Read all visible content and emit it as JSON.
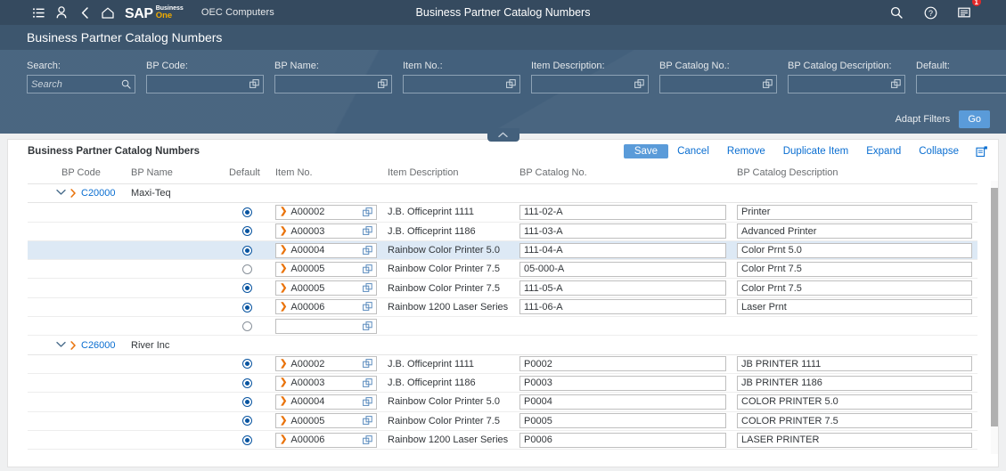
{
  "shell": {
    "icons": [
      "menu-icon",
      "user-icon",
      "back-icon",
      "home-icon"
    ],
    "logo": {
      "sap": "SAP",
      "business": "Business",
      "one": "One"
    },
    "company": "OEC Computers",
    "title": "Business Partner Catalog Numbers",
    "right_icons": [
      "search-icon",
      "help-icon",
      "messages-icon"
    ],
    "notification_count": "1"
  },
  "page": {
    "title": "Business Partner Catalog Numbers"
  },
  "filters": {
    "fields": [
      {
        "label": "Search:",
        "value": "",
        "placeholder": "Search",
        "icon": "search-icon",
        "width": 122
      },
      {
        "label": "BP Code:",
        "value": "",
        "placeholder": "",
        "icon": "value-help-icon",
        "width": 132
      },
      {
        "label": "BP Name:",
        "value": "",
        "placeholder": "",
        "icon": "value-help-icon",
        "width": 132
      },
      {
        "label": "Item No.:",
        "value": "",
        "placeholder": "",
        "icon": "value-help-icon",
        "width": 132
      },
      {
        "label": "Item Description:",
        "value": "",
        "placeholder": "",
        "icon": "value-help-icon",
        "width": 132
      },
      {
        "label": "BP Catalog No.:",
        "value": "",
        "placeholder": "",
        "icon": "value-help-icon",
        "width": 132
      },
      {
        "label": "BP Catalog Description:",
        "value": "",
        "placeholder": "",
        "icon": "value-help-icon",
        "width": 132
      },
      {
        "label": "Default:",
        "value": "",
        "placeholder": "",
        "icon": "chevron-down-icon",
        "width": 125
      }
    ],
    "adapt_filters": "Adapt Filters",
    "go": "Go"
  },
  "table": {
    "title": "Business Partner Catalog Numbers",
    "toolbar": [
      {
        "label": "Save",
        "primary": true
      },
      {
        "label": "Cancel",
        "primary": false
      },
      {
        "label": "Remove",
        "primary": false
      },
      {
        "label": "Duplicate Item",
        "primary": false
      },
      {
        "label": "Expand",
        "primary": false
      },
      {
        "label": "Collapse",
        "primary": false
      }
    ],
    "settings_icon": "table-settings-icon",
    "columns": [
      "BP Code",
      "BP Name",
      "Default",
      "Item No.",
      "Item Description",
      "BP Catalog No.",
      "BP Catalog Description"
    ],
    "groups": [
      {
        "bp_code": "C20000",
        "bp_name": "Maxi-Teq",
        "expanded": true,
        "rows": [
          {
            "default": true,
            "item_no": "A00002",
            "item_description": "J.B. Officeprint 1111",
            "catalog_no": "111-02-A",
            "catalog_description": "Printer",
            "selected": false
          },
          {
            "default": true,
            "item_no": "A00003",
            "item_description": "J.B. Officeprint 1186",
            "catalog_no": "111-03-A",
            "catalog_description": "Advanced Printer",
            "selected": false
          },
          {
            "default": true,
            "item_no": "A00004",
            "item_description": "Rainbow Color Printer 5.0",
            "catalog_no": "111-04-A",
            "catalog_description": "Color Prnt 5.0",
            "selected": true
          },
          {
            "default": false,
            "item_no": "A00005",
            "item_description": "Rainbow Color Printer 7.5",
            "catalog_no": "05-000-A",
            "catalog_description": "Color Prnt 7.5",
            "selected": false
          },
          {
            "default": true,
            "item_no": "A00005",
            "item_description": "Rainbow Color Printer 7.5",
            "catalog_no": "111-05-A",
            "catalog_description": "Color Prnt 7.5",
            "selected": false
          },
          {
            "default": true,
            "item_no": "A00006",
            "item_description": "Rainbow 1200 Laser Series",
            "catalog_no": "111-06-A",
            "catalog_description": "Laser Prnt",
            "selected": false
          },
          {
            "default": false,
            "item_no": "",
            "item_description": "",
            "catalog_no": "",
            "catalog_description": "",
            "selected": false
          }
        ]
      },
      {
        "bp_code": "C26000",
        "bp_name": "River Inc",
        "expanded": true,
        "rows": [
          {
            "default": true,
            "item_no": "A00002",
            "item_description": "J.B. Officeprint 1111",
            "catalog_no": "P0002",
            "catalog_description": "JB PRINTER 1111",
            "selected": false
          },
          {
            "default": true,
            "item_no": "A00003",
            "item_description": "J.B. Officeprint 1186",
            "catalog_no": "P0003",
            "catalog_description": "JB PRINTER 1186",
            "selected": false
          },
          {
            "default": true,
            "item_no": "A00004",
            "item_description": "Rainbow Color Printer 5.0",
            "catalog_no": "P0004",
            "catalog_description": "COLOR PRINTER 5.0",
            "selected": false
          },
          {
            "default": true,
            "item_no": "A00005",
            "item_description": "Rainbow Color Printer 7.5",
            "catalog_no": "P0005",
            "catalog_description": "COLOR PRINTER 7.5",
            "selected": false
          },
          {
            "default": true,
            "item_no": "A00006",
            "item_description": "Rainbow 1200 Laser Series",
            "catalog_no": "P0006",
            "catalog_description": "LASER PRINTER",
            "selected": false
          }
        ]
      }
    ]
  },
  "colors": {
    "shell_bg": "#354a5f",
    "titlebar_bg": "#3d566e",
    "filterbar_bg": "#43607c",
    "accent_blue": "#0a6ed1",
    "button_blue": "#5a9bd9",
    "link_orange": "#e9730c",
    "badge_red": "#e52929",
    "row_selected": "#dde9f5"
  }
}
